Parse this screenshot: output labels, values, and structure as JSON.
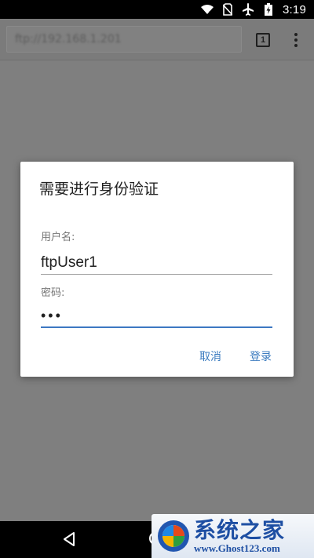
{
  "status_bar": {
    "time": "3:19"
  },
  "browser": {
    "url": "ftp://192.168.1.201",
    "tab_count": "1"
  },
  "dialog": {
    "title": "需要进行身份验证",
    "username_label": "用户名:",
    "username_value": "ftpUser1",
    "password_label": "密码:",
    "password_value": "•••",
    "cancel_label": "取消",
    "login_label": "登录"
  },
  "watermark": {
    "name": "系统之家",
    "url": "www.Ghost123.com"
  },
  "colors": {
    "accent": "#3b7bbf",
    "scrim": "#7f7f7f",
    "status_bar": "#000000"
  },
  "icons": [
    "wifi-icon",
    "no-sim-icon",
    "airplane-icon",
    "battery-icon",
    "overflow-menu-icon",
    "back-icon",
    "home-icon"
  ]
}
